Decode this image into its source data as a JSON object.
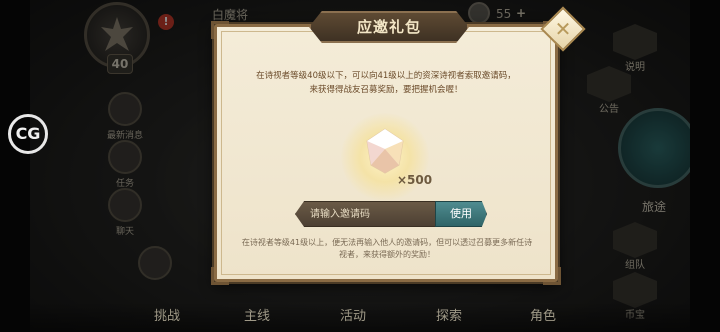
{
  "hud": {
    "player_name": "白魔将",
    "alert": "!",
    "level": "40",
    "resource_amount": "55",
    "resource_plus": "+"
  },
  "left_menu": [
    {
      "label": "最新消息"
    },
    {
      "label": "任务"
    },
    {
      "label": "聊天"
    }
  ],
  "right_menu": [
    {
      "label": "说明"
    },
    {
      "label": "公告"
    },
    {
      "label": "旅途"
    },
    {
      "label": "组队"
    },
    {
      "label": "币宝"
    }
  ],
  "bottom_tabs": [
    "挑战",
    "主线",
    "活动",
    "探索",
    "角色"
  ],
  "watermark": "CG",
  "dialog": {
    "title": "应邀礼包",
    "close_icon": "close-icon",
    "description_line1": "在诗视者等级40级以下，可以向41级以上的资深诗视者索取邀请码，",
    "description_line2": "来获得得战友召募奖励，要把握机会喔！",
    "reward_quantity": "×500",
    "input_placeholder": "请输入邀请码",
    "use_button": "使用",
    "note_line1": "在诗视者等级41级以上，便无法再输入他人的邀请码，但可以透过召募更多新任诗",
    "note_line2": "视者，来获得额外的奖励！"
  },
  "colors": {
    "parchment": "#f0e6cd",
    "frame": "#8a6b44",
    "title_plate": "#4c3c2a",
    "teal_button": "#3f7a7e",
    "text_brown": "#6b4b2a"
  }
}
